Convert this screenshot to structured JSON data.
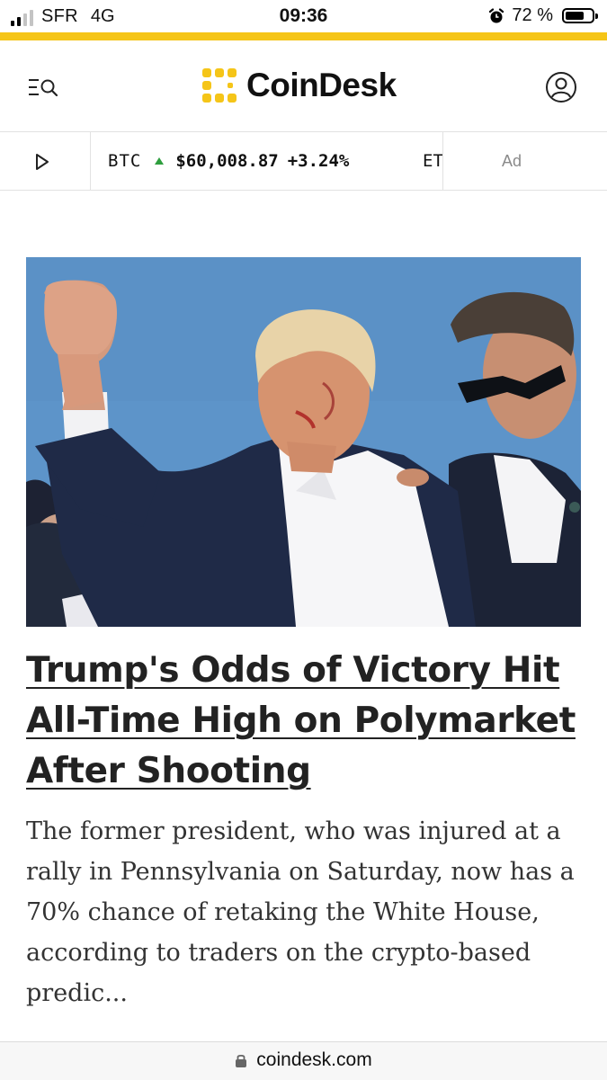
{
  "status_bar": {
    "carrier": "SFR",
    "network": "4G",
    "time": "09:36",
    "battery_percent": "72 %",
    "battery_level": 0.72,
    "signal_bars_active": 2,
    "signal_bars_total": 4
  },
  "colors": {
    "accent_yellow": "#f5c518",
    "ticker_up_green": "#2e9e3e",
    "text_dark": "#222222",
    "hero_sky": "#5b92c8"
  },
  "header": {
    "brand_name": "CoinDesk",
    "menu_icon": "menu-search-icon",
    "account_icon": "account-icon"
  },
  "ticker": {
    "play_icon": "play-icon",
    "items": [
      {
        "symbol": "BTC",
        "direction": "up",
        "price": "$60,008.87",
        "change": "+3.24%"
      }
    ],
    "next_symbol_partial": "ET",
    "ad_label": "Ad"
  },
  "article": {
    "headline": "Trump's Odds of Victory Hit All-Time High on Polymarket After Shooting",
    "summary": "The former president, who was injured at a rally in Pennsylvania on Saturday, now has a 70% chance of retaking the White House, according to traders on the crypto-based predic..."
  },
  "url_bar": {
    "domain": "coindesk.com",
    "lock_icon": "lock-icon"
  }
}
